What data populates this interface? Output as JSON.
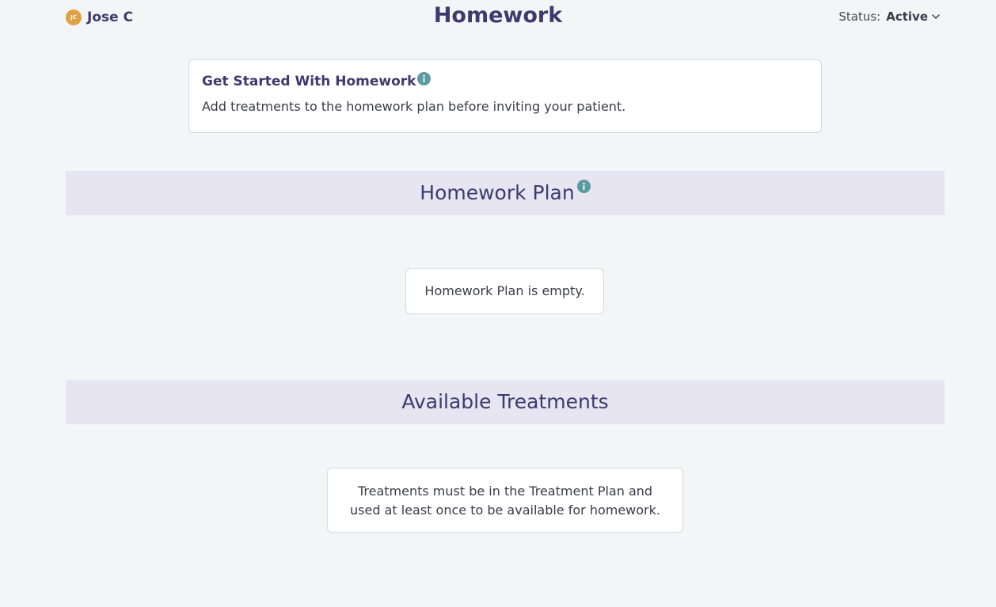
{
  "header": {
    "avatar_initials": "JC",
    "avatar_color": "#e0a145",
    "user_name": "Jose C",
    "title": "Homework",
    "status_label": "Status:",
    "status_value": "Active",
    "status_icon": "chevron-down-icon"
  },
  "get_started": {
    "title": "Get Started With Homework",
    "info_icon": "info-icon",
    "description": "Add treatments to the homework plan before inviting your patient."
  },
  "homework_plan": {
    "title": "Homework Plan",
    "info_icon": "info-icon",
    "empty_message": "Homework Plan is empty."
  },
  "available_treatments": {
    "title": "Available Treatments",
    "empty_message": "Treatments must be in the Treatment Plan and used at least once to be available for homework."
  },
  "colors": {
    "accent": "#3d3a6e",
    "band": "#e7e5f1",
    "info": "#5b9aa0",
    "background": "#f4f5f7"
  }
}
